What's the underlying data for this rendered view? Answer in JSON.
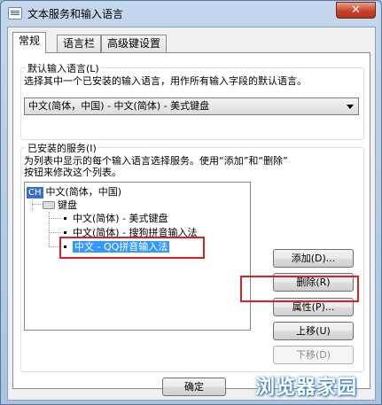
{
  "window": {
    "title": "文本服务和输入语言",
    "close_glyph": "✕"
  },
  "tabs": [
    {
      "label": "常规"
    },
    {
      "label": "语言栏"
    },
    {
      "label": "高级键设置"
    }
  ],
  "default_language": {
    "group_label": "默认输入语言(L)",
    "description": "选择其中一个已安装的输入语言，用作所有输入字段的默认语言。",
    "selected_value": "中文(简体，中国) - 中文(简体) - 美式键盘"
  },
  "installed_services": {
    "group_label": "已安装的服务(I)",
    "description_line1": "为列表中显示的每个输入语言选择服务。使用“添加”和“删除”",
    "description_line2": "按钮来修改这个列表。",
    "language_badge": "CH",
    "language_name": "中文(简体，中国)",
    "keyboard_label": "键盘",
    "items": [
      {
        "label": "中文(简体) - 美式键盘"
      },
      {
        "label": "中文(简体) - 搜狗拼音输入法"
      },
      {
        "label": "中文 - QQ拼音输入法"
      }
    ],
    "selected_item_index": 2
  },
  "buttons": {
    "add": "添加(D)...",
    "remove": "删除(R)",
    "properties": "属性(P)...",
    "move_up": "上移(U)",
    "move_down": "下移(D)",
    "ok": "确定"
  },
  "watermark": "浏览器家园",
  "colors": {
    "highlight": "#3399ff",
    "annotation_red": "#e02020",
    "badge_blue": "#3a6fc9"
  }
}
